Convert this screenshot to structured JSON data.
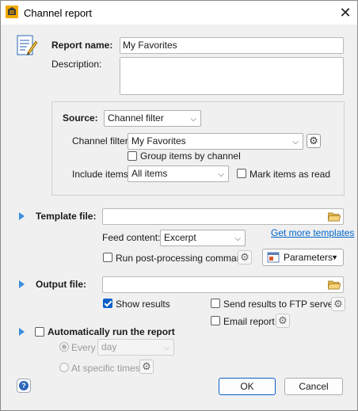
{
  "window": {
    "title": "Channel report"
  },
  "report": {
    "name_label": "Report name:",
    "name_value": "My Favorites",
    "description_label": "Description:",
    "description_value": ""
  },
  "source": {
    "label": "Source:",
    "value": "Channel filter",
    "channel_filter_label": "Channel filter:",
    "channel_filter_value": "My Favorites",
    "group_items_label": "Group items by channel",
    "group_items_checked": false,
    "include_items_label": "Include items:",
    "include_items_value": "All items",
    "mark_read_label": "Mark items as read",
    "mark_read_checked": false
  },
  "template": {
    "label": "Template file:",
    "value": "",
    "feed_content_label": "Feed content:",
    "feed_content_value": "Excerpt",
    "get_more_link": "Get more templates",
    "post_processing_label": "Run post-processing command",
    "post_processing_checked": false,
    "parameters_label": "Parameters"
  },
  "output": {
    "label": "Output file:",
    "value": "",
    "show_results_label": "Show results",
    "show_results_checked": true,
    "send_ftp_label": "Send results to FTP server",
    "send_ftp_checked": false,
    "email_label": "Email report",
    "email_checked": false
  },
  "auto_run": {
    "label": "Automatically run the report",
    "checked": false,
    "every_label": "Every",
    "every_value": "day",
    "specific_times_label": "At specific times"
  },
  "footer": {
    "help_label": "?",
    "ok_label": "OK",
    "cancel_label": "Cancel"
  },
  "colors": {
    "accent": "#0b5ec9",
    "link": "#0066cc",
    "section_arrow": "#3b8ee0"
  },
  "icons": [
    "app-icon",
    "close-icon",
    "report-document-icon",
    "settings-icon",
    "folder-open-icon",
    "parameters-icon",
    "help-icon",
    "dropdown-arrow-icon",
    "expand-arrow-icon"
  ]
}
